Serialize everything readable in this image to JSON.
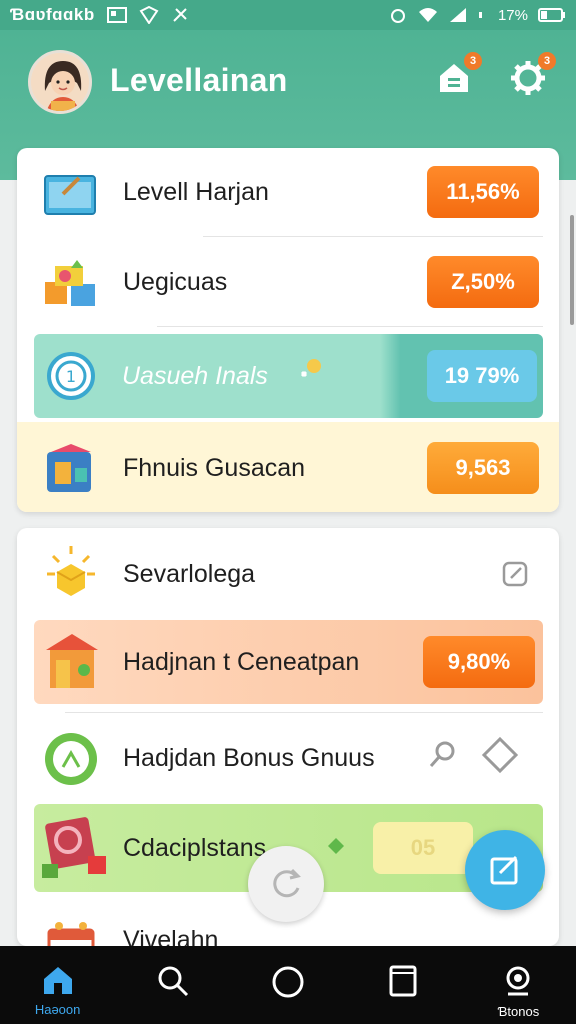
{
  "status_bar": {
    "carrier_text": "Ɓɑʋfɑɑkb",
    "battery_text": "17%"
  },
  "header": {
    "title": "Levellainan",
    "home_badge": "3",
    "settings_badge": "3"
  },
  "card1": {
    "rows": [
      {
        "label": "Levell Harjan",
        "value": "11,56%"
      },
      {
        "label": "Uegicuas",
        "value": "Z,50%"
      },
      {
        "label": "Uasueh Inals",
        "value": "19 79%"
      },
      {
        "label": "Fhnuis Gusacan",
        "value": "9,563"
      }
    ]
  },
  "card2": {
    "rows": [
      {
        "label": "Sevarlolega"
      },
      {
        "label": "Hadjnan t Ceneatpan",
        "value": "9,80%"
      },
      {
        "label": "Hadjdan Bonus Gnuus"
      },
      {
        "label": "Cdaciplstans",
        "value": "05"
      },
      {
        "label": "Vivelahn"
      }
    ]
  },
  "bottom_nav": {
    "items": [
      {
        "label": "Haəoon"
      },
      {
        "label": ""
      },
      {
        "label": ""
      },
      {
        "label": ""
      },
      {
        "label": "Ɓtonos"
      }
    ]
  },
  "colors": {
    "header_green": "#4fb394",
    "accent_orange": "#f46b10",
    "accent_blue": "#3fb4e6"
  }
}
